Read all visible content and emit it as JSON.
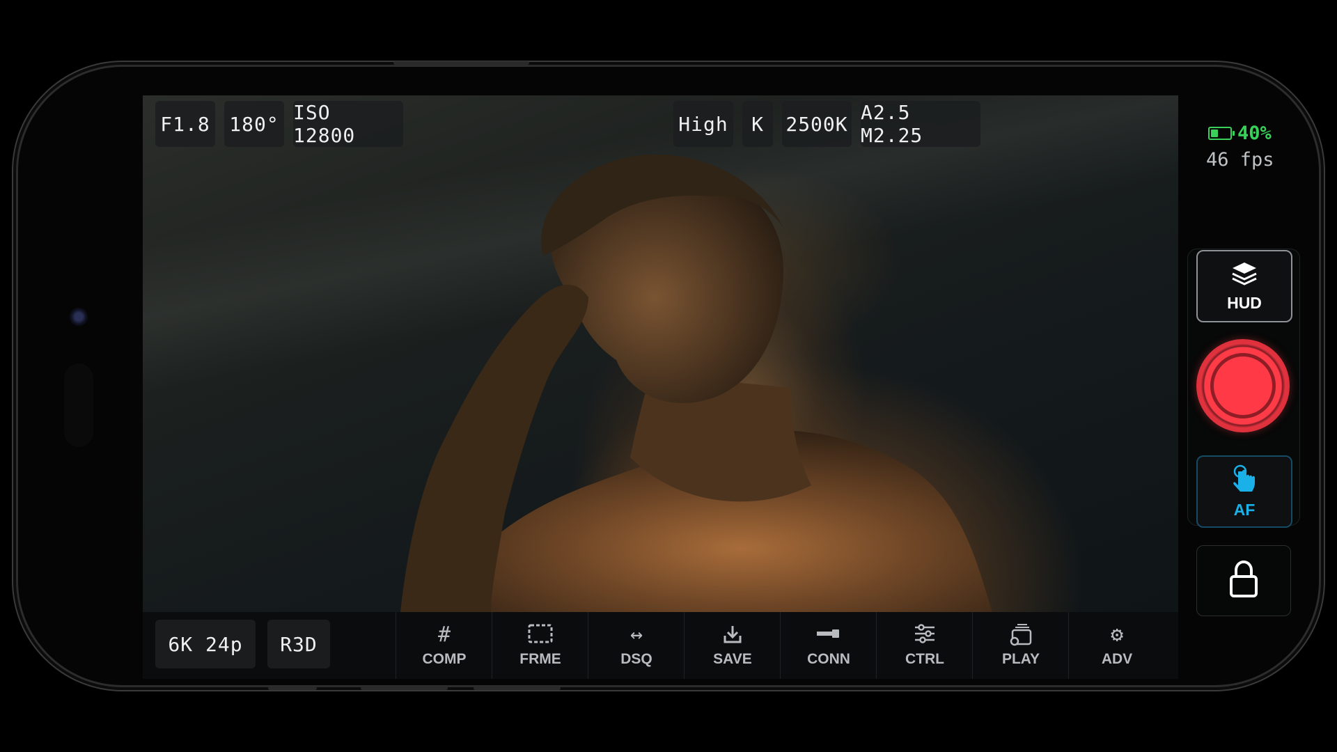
{
  "top_left_chips": [
    {
      "label": "F1.8"
    },
    {
      "label": "180°"
    },
    {
      "label": "ISO 12800"
    }
  ],
  "top_right_chips": [
    {
      "label": "High"
    },
    {
      "label": "K"
    },
    {
      "label": "2500K"
    },
    {
      "label": "A2.5 M2.25"
    }
  ],
  "status": {
    "battery_percent_label": "40%",
    "battery_level": 0.4,
    "fps": "46 fps",
    "accent_color": "#3ad15b"
  },
  "side_panel": {
    "hud_label": "HUD",
    "af_label": "AF",
    "af_color": "#1ab0e8",
    "record_color": "#ff3a46"
  },
  "bottom_left_chips": [
    {
      "label": "6K 24p"
    },
    {
      "label": "R3D"
    }
  ],
  "toolbar": [
    {
      "label": "COMP",
      "icon": "grid-icon"
    },
    {
      "label": "FRME",
      "icon": "frame-icon"
    },
    {
      "label": "DSQ",
      "icon": "desqueeze-arrows-icon"
    },
    {
      "label": "SAVE",
      "icon": "save-download-icon"
    },
    {
      "label": "CONN",
      "icon": "connector-icon"
    },
    {
      "label": "CTRL",
      "icon": "sliders-icon"
    },
    {
      "label": "PLAY",
      "icon": "playback-icon"
    },
    {
      "label": "ADV",
      "icon": "gear-icon"
    }
  ]
}
